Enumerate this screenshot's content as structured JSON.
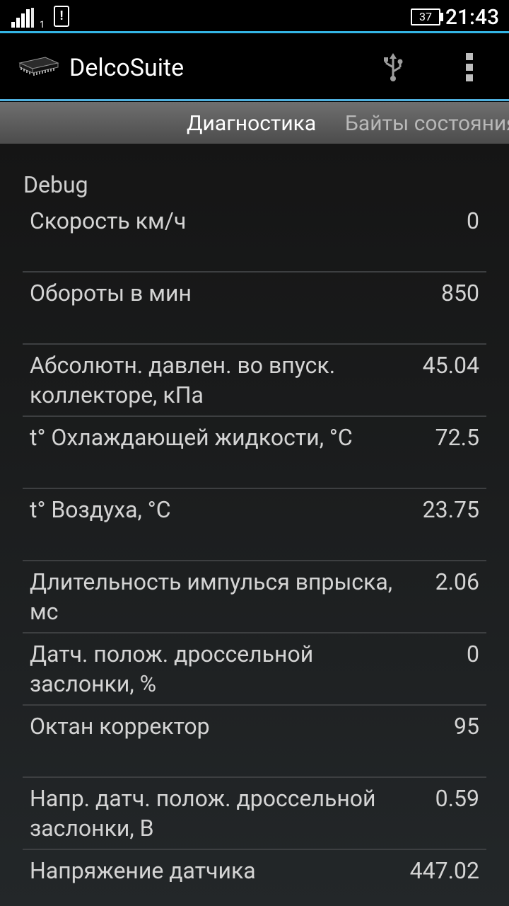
{
  "status_bar": {
    "sim_slot": "1",
    "alert_symbol": "!",
    "battery_level": "37",
    "time": "21:43",
    "icons": [
      "signal-icon",
      "alert-icon",
      "battery-icon"
    ]
  },
  "action_bar": {
    "app_icon": "chip-icon",
    "title": "DelcoSuite",
    "usb_icon": "usb-icon",
    "overflow_icon": "overflow-menu-icon"
  },
  "tabs": [
    {
      "label": "Диагностика",
      "active": true
    },
    {
      "label": "Байты состояния",
      "active": false
    }
  ],
  "section": {
    "title": "Debug"
  },
  "rows": [
    {
      "label": "Скорость км/ч",
      "value": "0"
    },
    {
      "label": "Обороты в мин",
      "value": "850"
    },
    {
      "label": "Абсолютн. давлен. во впуск. коллекторе, кПа",
      "value": "45.04"
    },
    {
      "label": "t° Охлаждающей жидкости, °C",
      "value": "72.5"
    },
    {
      "label": "t° Воздуха, °C",
      "value": "23.75"
    },
    {
      "label": "Длительность импулься впрыска, мс",
      "value": "2.06"
    },
    {
      "label": "Датч. полож. дроссельной заслонки, %",
      "value": "0"
    },
    {
      "label": "Октан корректор",
      "value": "95"
    },
    {
      "label": "Напр. датч. полож. дроссельной заслонки, В",
      "value": "0.59"
    },
    {
      "label": "Напряжение датчика",
      "value": "447.02"
    }
  ],
  "colors": {
    "accent": "#33b5e5",
    "background": "#000000",
    "text": "#d4d4d4"
  }
}
